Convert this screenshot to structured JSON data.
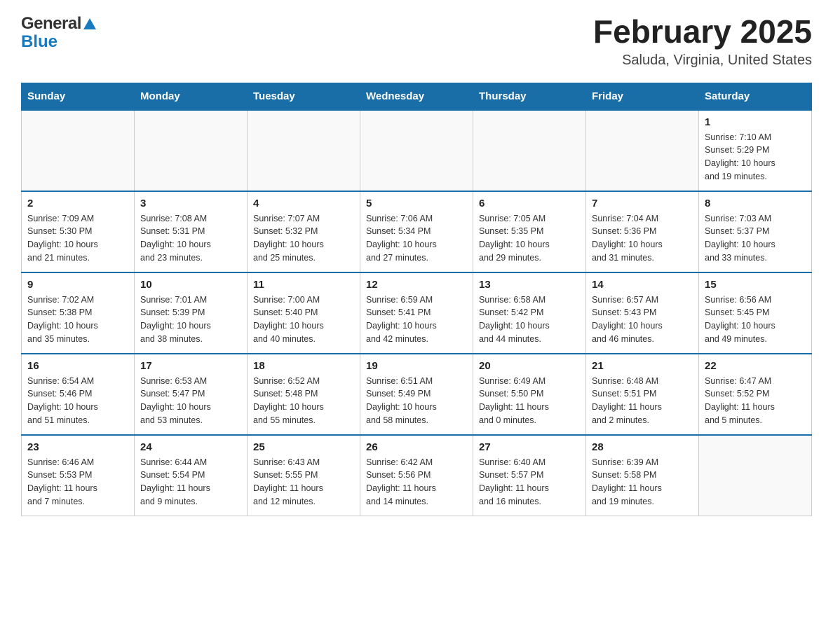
{
  "header": {
    "logo_general": "General",
    "logo_blue": "Blue",
    "month_title": "February 2025",
    "location": "Saluda, Virginia, United States"
  },
  "weekdays": [
    "Sunday",
    "Monday",
    "Tuesday",
    "Wednesday",
    "Thursday",
    "Friday",
    "Saturday"
  ],
  "weeks": [
    [
      {
        "day": "",
        "info": ""
      },
      {
        "day": "",
        "info": ""
      },
      {
        "day": "",
        "info": ""
      },
      {
        "day": "",
        "info": ""
      },
      {
        "day": "",
        "info": ""
      },
      {
        "day": "",
        "info": ""
      },
      {
        "day": "1",
        "info": "Sunrise: 7:10 AM\nSunset: 5:29 PM\nDaylight: 10 hours\nand 19 minutes."
      }
    ],
    [
      {
        "day": "2",
        "info": "Sunrise: 7:09 AM\nSunset: 5:30 PM\nDaylight: 10 hours\nand 21 minutes."
      },
      {
        "day": "3",
        "info": "Sunrise: 7:08 AM\nSunset: 5:31 PM\nDaylight: 10 hours\nand 23 minutes."
      },
      {
        "day": "4",
        "info": "Sunrise: 7:07 AM\nSunset: 5:32 PM\nDaylight: 10 hours\nand 25 minutes."
      },
      {
        "day": "5",
        "info": "Sunrise: 7:06 AM\nSunset: 5:34 PM\nDaylight: 10 hours\nand 27 minutes."
      },
      {
        "day": "6",
        "info": "Sunrise: 7:05 AM\nSunset: 5:35 PM\nDaylight: 10 hours\nand 29 minutes."
      },
      {
        "day": "7",
        "info": "Sunrise: 7:04 AM\nSunset: 5:36 PM\nDaylight: 10 hours\nand 31 minutes."
      },
      {
        "day": "8",
        "info": "Sunrise: 7:03 AM\nSunset: 5:37 PM\nDaylight: 10 hours\nand 33 minutes."
      }
    ],
    [
      {
        "day": "9",
        "info": "Sunrise: 7:02 AM\nSunset: 5:38 PM\nDaylight: 10 hours\nand 35 minutes."
      },
      {
        "day": "10",
        "info": "Sunrise: 7:01 AM\nSunset: 5:39 PM\nDaylight: 10 hours\nand 38 minutes."
      },
      {
        "day": "11",
        "info": "Sunrise: 7:00 AM\nSunset: 5:40 PM\nDaylight: 10 hours\nand 40 minutes."
      },
      {
        "day": "12",
        "info": "Sunrise: 6:59 AM\nSunset: 5:41 PM\nDaylight: 10 hours\nand 42 minutes."
      },
      {
        "day": "13",
        "info": "Sunrise: 6:58 AM\nSunset: 5:42 PM\nDaylight: 10 hours\nand 44 minutes."
      },
      {
        "day": "14",
        "info": "Sunrise: 6:57 AM\nSunset: 5:43 PM\nDaylight: 10 hours\nand 46 minutes."
      },
      {
        "day": "15",
        "info": "Sunrise: 6:56 AM\nSunset: 5:45 PM\nDaylight: 10 hours\nand 49 minutes."
      }
    ],
    [
      {
        "day": "16",
        "info": "Sunrise: 6:54 AM\nSunset: 5:46 PM\nDaylight: 10 hours\nand 51 minutes."
      },
      {
        "day": "17",
        "info": "Sunrise: 6:53 AM\nSunset: 5:47 PM\nDaylight: 10 hours\nand 53 minutes."
      },
      {
        "day": "18",
        "info": "Sunrise: 6:52 AM\nSunset: 5:48 PM\nDaylight: 10 hours\nand 55 minutes."
      },
      {
        "day": "19",
        "info": "Sunrise: 6:51 AM\nSunset: 5:49 PM\nDaylight: 10 hours\nand 58 minutes."
      },
      {
        "day": "20",
        "info": "Sunrise: 6:49 AM\nSunset: 5:50 PM\nDaylight: 11 hours\nand 0 minutes."
      },
      {
        "day": "21",
        "info": "Sunrise: 6:48 AM\nSunset: 5:51 PM\nDaylight: 11 hours\nand 2 minutes."
      },
      {
        "day": "22",
        "info": "Sunrise: 6:47 AM\nSunset: 5:52 PM\nDaylight: 11 hours\nand 5 minutes."
      }
    ],
    [
      {
        "day": "23",
        "info": "Sunrise: 6:46 AM\nSunset: 5:53 PM\nDaylight: 11 hours\nand 7 minutes."
      },
      {
        "day": "24",
        "info": "Sunrise: 6:44 AM\nSunset: 5:54 PM\nDaylight: 11 hours\nand 9 minutes."
      },
      {
        "day": "25",
        "info": "Sunrise: 6:43 AM\nSunset: 5:55 PM\nDaylight: 11 hours\nand 12 minutes."
      },
      {
        "day": "26",
        "info": "Sunrise: 6:42 AM\nSunset: 5:56 PM\nDaylight: 11 hours\nand 14 minutes."
      },
      {
        "day": "27",
        "info": "Sunrise: 6:40 AM\nSunset: 5:57 PM\nDaylight: 11 hours\nand 16 minutes."
      },
      {
        "day": "28",
        "info": "Sunrise: 6:39 AM\nSunset: 5:58 PM\nDaylight: 11 hours\nand 19 minutes."
      },
      {
        "day": "",
        "info": ""
      }
    ]
  ]
}
